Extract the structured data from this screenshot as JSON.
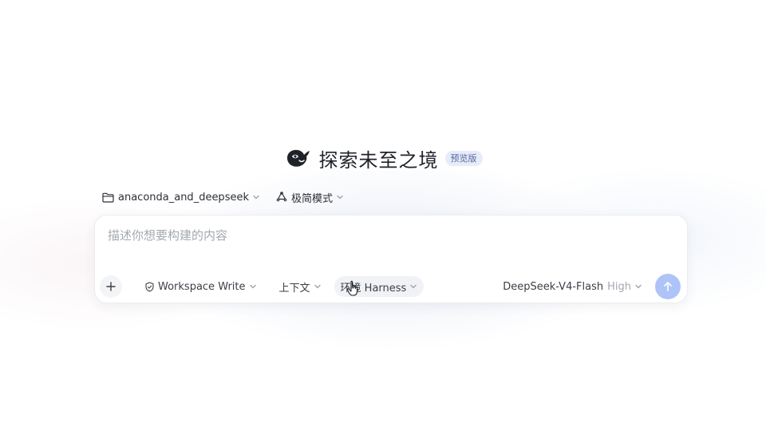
{
  "header": {
    "title": "探索未至之境",
    "badge": "预览版",
    "logo_icon": "whale-icon"
  },
  "context_bar": {
    "folder": {
      "label": "anaconda_and_deepseek",
      "icon": "folder-icon"
    },
    "mode": {
      "label": "极简模式",
      "icon": "recycle-icon"
    }
  },
  "composer": {
    "placeholder": "描述你想要构建的内容",
    "value": ""
  },
  "toolbar": {
    "add_icon": "plus-icon",
    "workspace": {
      "label": "Workspace Write",
      "icon": "shield-check-icon"
    },
    "context": {
      "label": "上下文"
    },
    "environment": {
      "label": "环境 Harness"
    },
    "model": {
      "name": "DeepSeek-V4-Flash",
      "level": "High"
    },
    "send_icon": "arrow-up-icon"
  },
  "colors": {
    "send_button": "#aec4f8",
    "badge_bg": "#e7ecfb",
    "badge_text": "#5a6b9a",
    "placeholder": "#a3a8b0"
  }
}
